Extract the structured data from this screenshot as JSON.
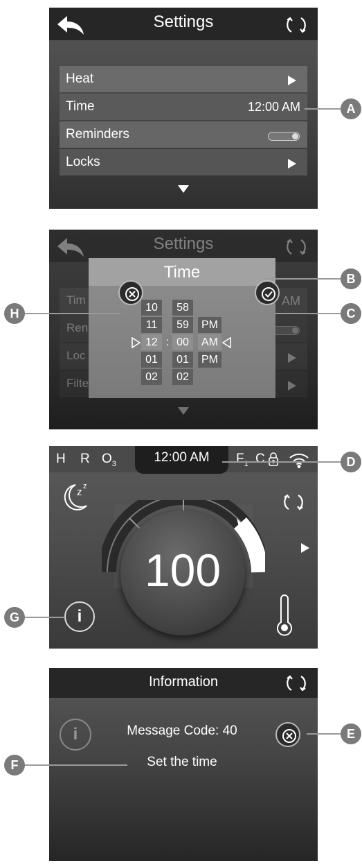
{
  "settings": {
    "title": "Settings",
    "rows": [
      {
        "label": "Heat"
      },
      {
        "label": "Time",
        "value": "12:00 AM"
      },
      {
        "label": "Reminders"
      },
      {
        "label": "Locks"
      }
    ]
  },
  "time_dialog": {
    "title": "Time",
    "bg_title": "Settings",
    "bg_time_value": "AM",
    "bg_rows": [
      "Tim",
      "Ren",
      "Loc",
      "Filte"
    ],
    "hours": [
      "10",
      "11",
      "12",
      "01",
      "02"
    ],
    "minutes": [
      "58",
      "59",
      "00",
      "01",
      "02"
    ],
    "ampm": [
      "PM",
      "AM",
      "PM"
    ],
    "separator": ":"
  },
  "main_screen": {
    "indicators": {
      "h": "H",
      "r": "R",
      "o3": "O",
      "o3_sub": "3",
      "f": "F",
      "f_sub": "1",
      "c": "C"
    },
    "time": "12:00 AM",
    "temperature": "100",
    "sleep_icon_text": "z",
    "sleep_icon_text_sup": "z"
  },
  "information": {
    "title": "Information",
    "message_code": "Message Code: 40",
    "message": "Set the time",
    "info_glyph": "i"
  },
  "callouts": [
    "A",
    "B",
    "C",
    "D",
    "E",
    "F",
    "G",
    "H"
  ]
}
